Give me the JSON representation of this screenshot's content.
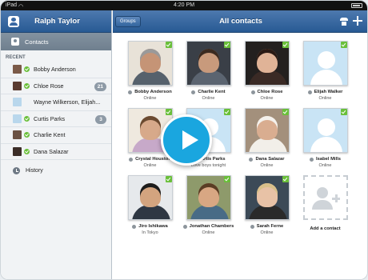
{
  "statusbar": {
    "carrier": "iPad",
    "time": "4:20 PM"
  },
  "sidebar": {
    "user_name": "Ralph Taylor",
    "contacts_label": "Contacts",
    "recent_label": "RECENT",
    "items": [
      {
        "label": "Bobby Anderson",
        "badge": "",
        "online": true,
        "avatar_color": "#7b5a48"
      },
      {
        "label": "Chloe Rose",
        "badge": "21",
        "online": true,
        "avatar_color": "#5a3b30"
      },
      {
        "label": "Wayne Wilkerson, Elijah...",
        "badge": "",
        "online": false,
        "avatar_color": "#b9d7ec"
      },
      {
        "label": "Curtis Parks",
        "badge": "3",
        "online": true,
        "avatar_color": "#b9d7ec"
      },
      {
        "label": "Charlie Kent",
        "badge": "",
        "online": true,
        "avatar_color": "#6b5244"
      },
      {
        "label": "Dana Salazar",
        "badge": "",
        "online": true,
        "avatar_color": "#3b2d27"
      }
    ],
    "history_label": "History"
  },
  "main": {
    "groups_label": "Groups",
    "title": "All contacts",
    "contacts": [
      {
        "name": "Bobby Anderson",
        "status": "Online",
        "photo": "person",
        "skin": "#c59476",
        "bg": "#e8e2d8",
        "shirt": "#56616c",
        "hair": "#9a9a9a"
      },
      {
        "name": "Charlie Kent",
        "status": "Online",
        "photo": "person",
        "skin": "#c89a7c",
        "bg": "#3a3f47",
        "shirt": "#5b6470",
        "hair": "#3a2a20"
      },
      {
        "name": "Chloe Rose",
        "status": "Online",
        "photo": "person",
        "skin": "#e0b397",
        "bg": "#23201f",
        "shirt": "#3a2a25",
        "hair": "#2a1a14"
      },
      {
        "name": "Elijah Walker",
        "status": "Online",
        "photo": "placeholder"
      },
      {
        "name": "Crystal Houston",
        "status": "Online",
        "photo": "person",
        "skin": "#d7a98a",
        "bg": "#efe9df",
        "shirt": "#c7a9c9",
        "hair": "#6b4a30"
      },
      {
        "name": "Curtis Parks",
        "status": "Love boys tonight",
        "photo": "placeholder"
      },
      {
        "name": "Dana Salazar",
        "status": "Online",
        "photo": "person",
        "skin": "#d9ad90",
        "bg": "#a3907c",
        "shirt": "#f2efe9",
        "hair": "#f4f1ec"
      },
      {
        "name": "Isabel Mills",
        "status": "Online",
        "photo": "placeholder"
      },
      {
        "name": "Jiro Ishikawa",
        "status": "In Tokyo",
        "photo": "person",
        "skin": "#d3a47f",
        "bg": "#e6e9ec",
        "shirt": "#2e3743",
        "hair": "#1c1c1c"
      },
      {
        "name": "Jonathan Chambers",
        "status": "Online",
        "photo": "person",
        "skin": "#d8a783",
        "bg": "#8e9a6b",
        "shirt": "#486b86",
        "hair": "#5a3d24"
      },
      {
        "name": "Sarah Ferne",
        "status": "Online",
        "photo": "person",
        "skin": "#e8c2a6",
        "bg": "#3c4a57",
        "shirt": "#2a2a2a",
        "hair": "#d9c08a"
      }
    ],
    "add_contact_label": "Add a contact"
  },
  "colors": {
    "header_blue": "#3a69a3",
    "online_green": "#6abf3a",
    "play_blue": "#1aa6df"
  }
}
